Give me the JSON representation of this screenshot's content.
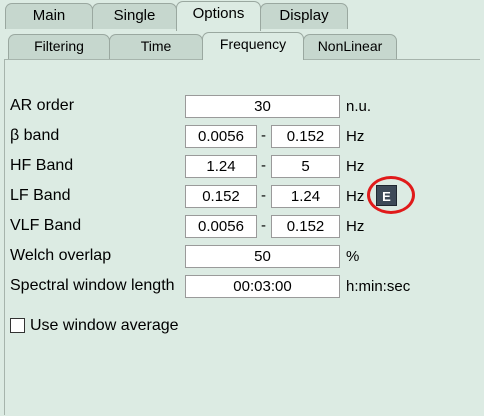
{
  "tabs": [
    {
      "label": "Main",
      "active": false
    },
    {
      "label": "Single",
      "active": false
    },
    {
      "label": "Options",
      "active": true
    },
    {
      "label": "Display",
      "active": false
    }
  ],
  "subtabs": [
    {
      "label": "Filtering",
      "active": false
    },
    {
      "label": "Time",
      "active": false
    },
    {
      "label": "Frequency",
      "active": true
    },
    {
      "label": "NonLinear",
      "active": false
    }
  ],
  "ar_order": {
    "label": "AR order",
    "value": "30",
    "unit": "n.u."
  },
  "beta_band": {
    "label": "β band",
    "low": "0.0056",
    "high": "0.152",
    "unit": "Hz"
  },
  "hf_band": {
    "label": "HF Band",
    "low": "1.24",
    "high": "5",
    "unit": "Hz"
  },
  "lf_band": {
    "label": "LF Band",
    "low": "0.152",
    "high": "1.24",
    "unit": "Hz",
    "edit_button": "E"
  },
  "vlf_band": {
    "label": "VLF Band",
    "low": "0.0056",
    "high": "0.152",
    "unit": "Hz"
  },
  "welch_overlap": {
    "label": "Welch overlap",
    "value": "50",
    "unit": "%"
  },
  "spectral_window": {
    "label": "Spectral window length",
    "value": "00:03:00",
    "unit": "h:min:sec"
  },
  "use_window_average": {
    "label": "Use window average",
    "checked": false
  },
  "separator": "-",
  "colors": {
    "background": "#dcebe3",
    "highlight_ring": "#e01a1a",
    "edit_button": "#3d4a58"
  }
}
